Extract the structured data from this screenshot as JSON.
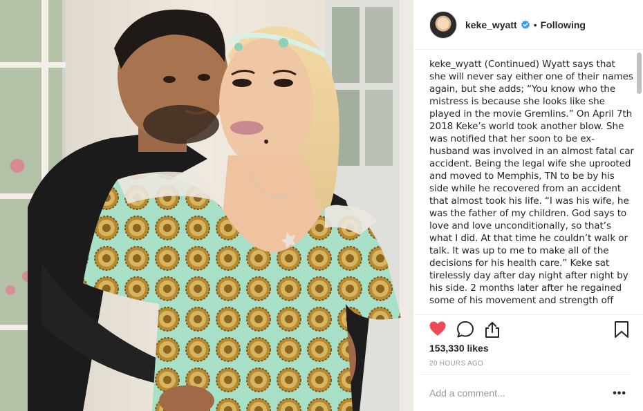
{
  "post": {
    "username": "keke_wyatt",
    "verified_icon": "verified-badge-icon",
    "separator": "•",
    "follow_state": "Following",
    "caption_user": "keke_wyatt",
    "caption_text": " (Continued) Wyatt says that she will never say either one of their names again, but she adds; “You know who the mistress is because she looks like she played in the movie Gremlins.” On April 7th 2018 Keke’s world took another blow. She was notified that her soon to be ex-husband was involved in an almost fatal car accident. Being the legal wife she uprooted and moved to Memphis, TN to be by his side while he recovered from an accident that almost took his life. “I was his wife, he was the father of my children. God says to love and love unconditionally, so that’s what I did. At that time he couldn’t walk or talk. It was up to me to make all of the decisions for his health care.” Keke sat tirelessly day after day night after night by his side. 2 months later after he regained some of his movement and strength off",
    "likes": "153,330 likes",
    "timestamp": "20 HOURS AGO",
    "comment_placeholder": "Add a comment...",
    "more_label": "•••"
  },
  "icons": {
    "like": "heart-filled-icon",
    "comment": "speech-bubble-icon",
    "share": "share-upload-icon",
    "save": "bookmark-icon"
  },
  "colors": {
    "heart": "#ed4956",
    "verified": "#3897f0",
    "muted_text": "#999999",
    "text": "#262626",
    "divider": "#efefef"
  }
}
